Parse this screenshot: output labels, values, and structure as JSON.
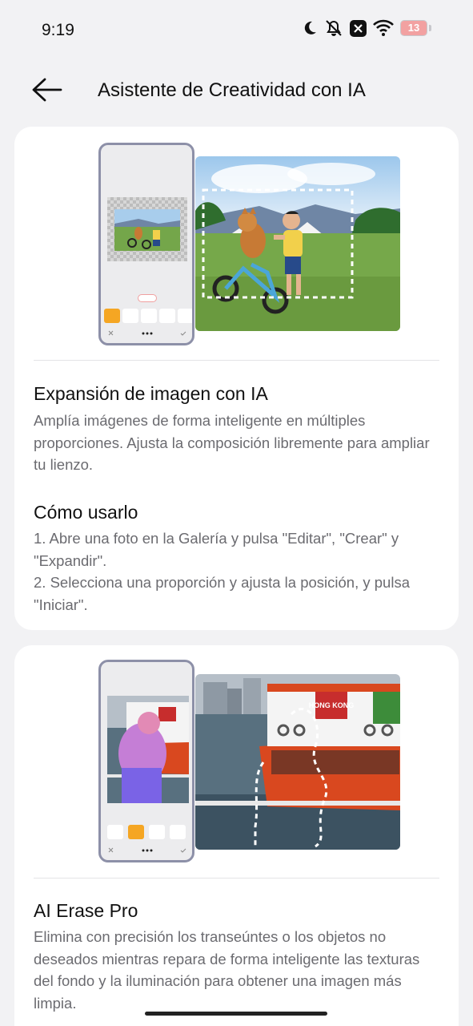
{
  "status_bar": {
    "time": "9:19",
    "battery_level": "13",
    "icons": [
      "moon-icon",
      "vibrate-off-icon",
      "x-notification-icon",
      "wifi-icon",
      "battery-icon"
    ]
  },
  "header": {
    "title": "Asistente de Creatividad con IA",
    "back_icon": "arrow-left-icon"
  },
  "cards": [
    {
      "title": "Expansión de imagen con IA",
      "description": "Amplía imágenes de forma inteligente en múltiples proporciones. Ajusta la composición libremente para ampliar tu lienzo.",
      "howto_title": "Cómo usarlo",
      "steps": [
        "1. Abre una foto en la Galería y pulsa \"Editar\", \"Crear\" y \"Expandir\".",
        "2. Selecciona una proporción y ajusta la posición, y pulsa \"Iniciar\"."
      ]
    },
    {
      "title": "AI Erase Pro",
      "description": "Elimina con precisión los transeúntes o los objetos no deseados mientras repara de forma inteligente las texturas del fondo y la iluminación para obtener una imagen más limpia.",
      "sign_text": "HONG KONG"
    }
  ],
  "colors": {
    "accent": "#f5a623",
    "background": "#f2f2f4",
    "card": "#ffffff",
    "text_secondary": "#6b6b70",
    "battery_low": "#f2a1a1"
  }
}
